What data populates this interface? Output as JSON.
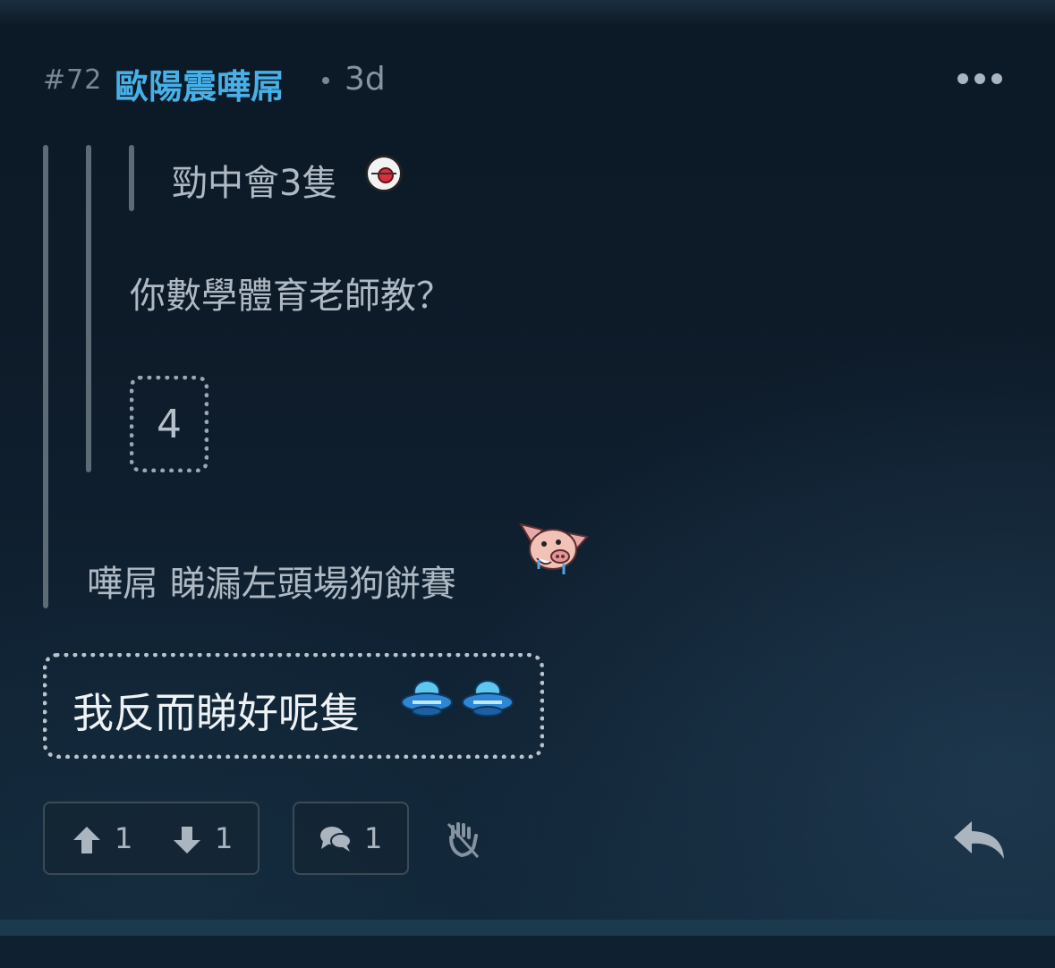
{
  "post": {
    "number": "#72",
    "username": "歐陽震嘩屌",
    "timestamp": "3d"
  },
  "quotes": {
    "level3_text": "勁中會3隻",
    "level2_text": "你數學體育老師教？",
    "collapsed_count": "4",
    "level1_text": "嘩屌 睇漏左頭場狗餅賽"
  },
  "content": {
    "main_text": "我反而睇好呢隻"
  },
  "emotes": {
    "cross_emote": "crosshair-emote",
    "pig_emote": "pig-emote",
    "ufo_emote": "ufo-emote"
  },
  "actions": {
    "upvote_count": "1",
    "downvote_count": "1",
    "reply_count": "1"
  },
  "icons": {
    "more": "more-icon",
    "upvote": "arrow-up-icon",
    "downvote": "arrow-down-icon",
    "comment": "comment-icon",
    "hand": "hand-icon",
    "reply": "reply-icon"
  },
  "colors": {
    "username": "#48b0e6",
    "background": "#0d1a28",
    "text": "#aeb9c3"
  }
}
